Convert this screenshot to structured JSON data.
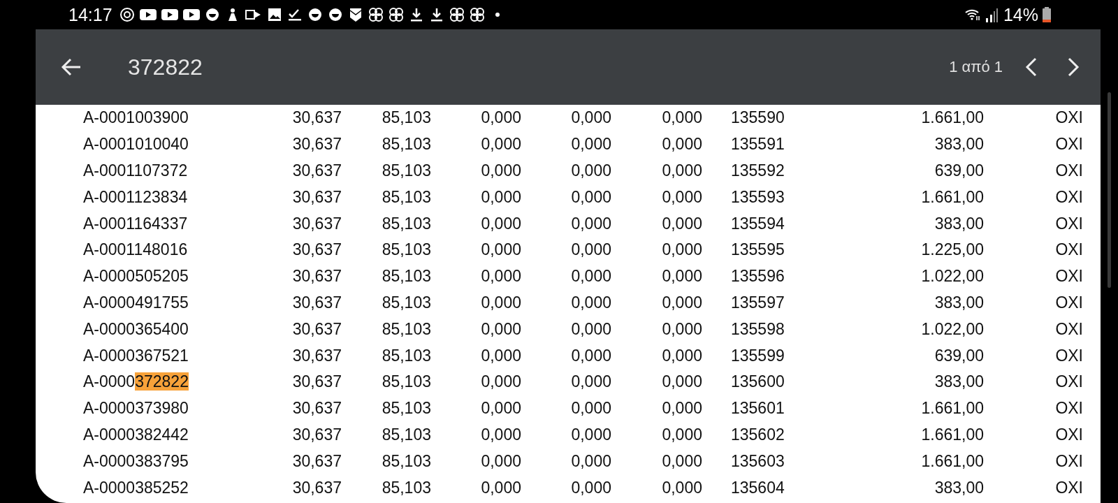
{
  "status_bar": {
    "time": "14:17",
    "battery": "14%"
  },
  "find_bar": {
    "query": "372822",
    "match_count": "1 από 1"
  },
  "table": {
    "rows": [
      {
        "code": [
          {
            "text": "A-0001003900",
            "highlighted": false
          }
        ],
        "cells": [
          "30,637",
          "85,103",
          "0,000",
          "0,000",
          "0,000",
          "135590",
          "1.661,00",
          "OXI"
        ]
      },
      {
        "code": [
          {
            "text": "A-0001010040",
            "highlighted": false
          }
        ],
        "cells": [
          "30,637",
          "85,103",
          "0,000",
          "0,000",
          "0,000",
          "135591",
          "383,00",
          "OXI"
        ]
      },
      {
        "code": [
          {
            "text": "A-0001107372",
            "highlighted": false
          }
        ],
        "cells": [
          "30,637",
          "85,103",
          "0,000",
          "0,000",
          "0,000",
          "135592",
          "639,00",
          "OXI"
        ]
      },
      {
        "code": [
          {
            "text": "A-0001123834",
            "highlighted": false
          }
        ],
        "cells": [
          "30,637",
          "85,103",
          "0,000",
          "0,000",
          "0,000",
          "135593",
          "1.661,00",
          "OXI"
        ]
      },
      {
        "code": [
          {
            "text": "A-0001164337",
            "highlighted": false
          }
        ],
        "cells": [
          "30,637",
          "85,103",
          "0,000",
          "0,000",
          "0,000",
          "135594",
          "383,00",
          "OXI"
        ]
      },
      {
        "code": [
          {
            "text": "A-0001148016",
            "highlighted": false
          }
        ],
        "cells": [
          "30,637",
          "85,103",
          "0,000",
          "0,000",
          "0,000",
          "135595",
          "1.225,00",
          "OXI"
        ]
      },
      {
        "code": [
          {
            "text": "A-0000505205",
            "highlighted": false
          }
        ],
        "cells": [
          "30,637",
          "85,103",
          "0,000",
          "0,000",
          "0,000",
          "135596",
          "1.022,00",
          "OXI"
        ]
      },
      {
        "code": [
          {
            "text": "A-0000491755",
            "highlighted": false
          }
        ],
        "cells": [
          "30,637",
          "85,103",
          "0,000",
          "0,000",
          "0,000",
          "135597",
          "383,00",
          "OXI"
        ]
      },
      {
        "code": [
          {
            "text": "A-0000365400",
            "highlighted": false
          }
        ],
        "cells": [
          "30,637",
          "85,103",
          "0,000",
          "0,000",
          "0,000",
          "135598",
          "1.022,00",
          "OXI"
        ]
      },
      {
        "code": [
          {
            "text": "A-0000367521",
            "highlighted": false
          }
        ],
        "cells": [
          "30,637",
          "85,103",
          "0,000",
          "0,000",
          "0,000",
          "135599",
          "639,00",
          "OXI"
        ]
      },
      {
        "code": [
          {
            "text": "A-0000",
            "highlighted": false
          },
          {
            "text": "372822",
            "highlighted": true
          }
        ],
        "cells": [
          "30,637",
          "85,103",
          "0,000",
          "0,000",
          "0,000",
          "135600",
          "383,00",
          "OXI"
        ]
      },
      {
        "code": [
          {
            "text": "A-0000373980",
            "highlighted": false
          }
        ],
        "cells": [
          "30,637",
          "85,103",
          "0,000",
          "0,000",
          "0,000",
          "135601",
          "1.661,00",
          "OXI"
        ]
      },
      {
        "code": [
          {
            "text": "A-0000382442",
            "highlighted": false
          }
        ],
        "cells": [
          "30,637",
          "85,103",
          "0,000",
          "0,000",
          "0,000",
          "135602",
          "1.661,00",
          "OXI"
        ]
      },
      {
        "code": [
          {
            "text": "A-0000383795",
            "highlighted": false
          }
        ],
        "cells": [
          "30,637",
          "85,103",
          "0,000",
          "0,000",
          "0,000",
          "135603",
          "1.661,00",
          "OXI"
        ]
      },
      {
        "code": [
          {
            "text": "A-0000385252",
            "highlighted": false
          }
        ],
        "cells": [
          "30,637",
          "85,103",
          "0,000",
          "0,000",
          "0,000",
          "135604",
          "383,00",
          "OXI"
        ]
      }
    ]
  }
}
